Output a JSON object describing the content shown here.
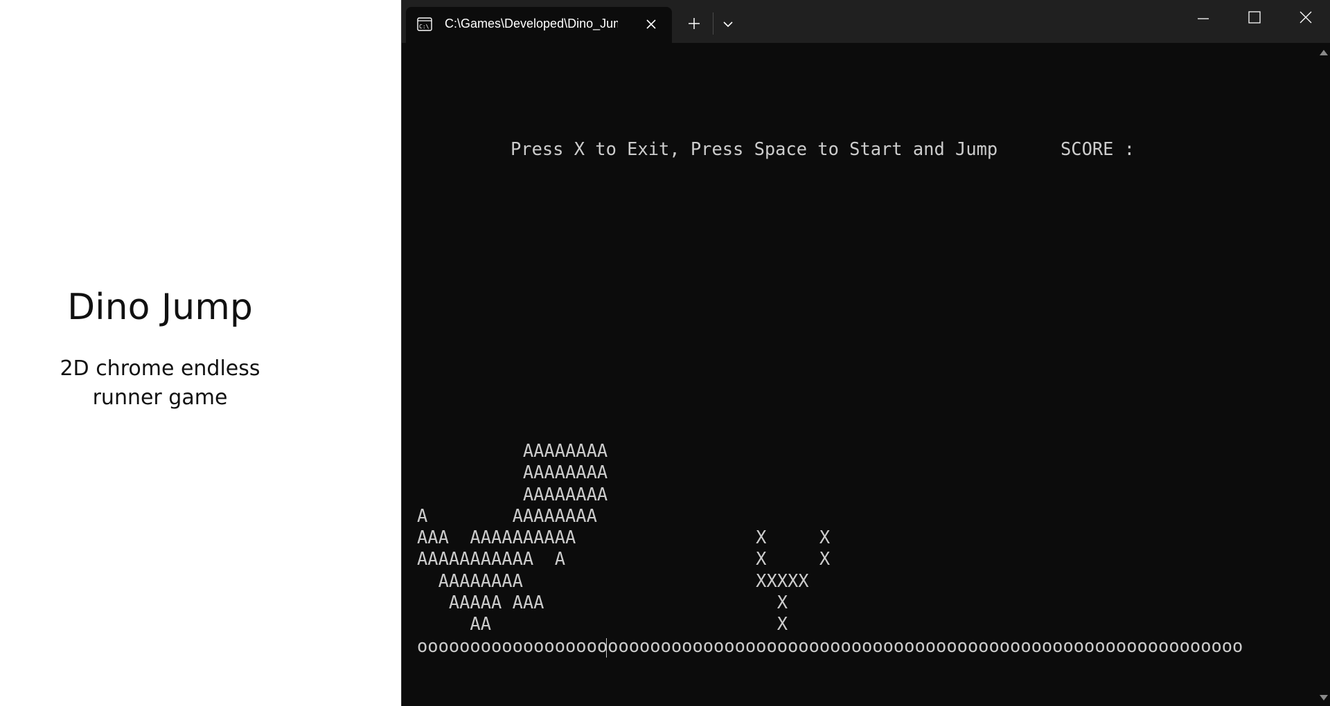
{
  "slide": {
    "title": "Dino Jump",
    "subtitle": "2D chrome endless runner game"
  },
  "terminal": {
    "tab_title": "C:\\Games\\Developed\\Dino_Jump",
    "tab_icon": "terminal-icon",
    "instructions": "Press X to Exit, Press Space to Start and Jump",
    "score_label": "SCORE :",
    "game_art": "          AAAAAAAA\n          AAAAAAAA\n          AAAAAAAA\nA        AAAAAAAA\nAAA  AAAAAAAAAA                 X     X\nAAAAAAAAAAA  A                  X     X\n  AAAAAAAA                      XXXXX\n   AAAAA AAA                      X\n     AA                           X",
    "ground": "oooooooooooooooooooooooooooooooooooooooooooooooooooooooooooooooooooooooooooooo"
  },
  "window_controls": {
    "minimize": "minimize-icon",
    "maximize": "maximize-icon",
    "close": "close-icon"
  },
  "colors": {
    "terminal_bg": "#0c0c0c",
    "titlebar_bg": "#202020",
    "text": "#cccccc"
  }
}
